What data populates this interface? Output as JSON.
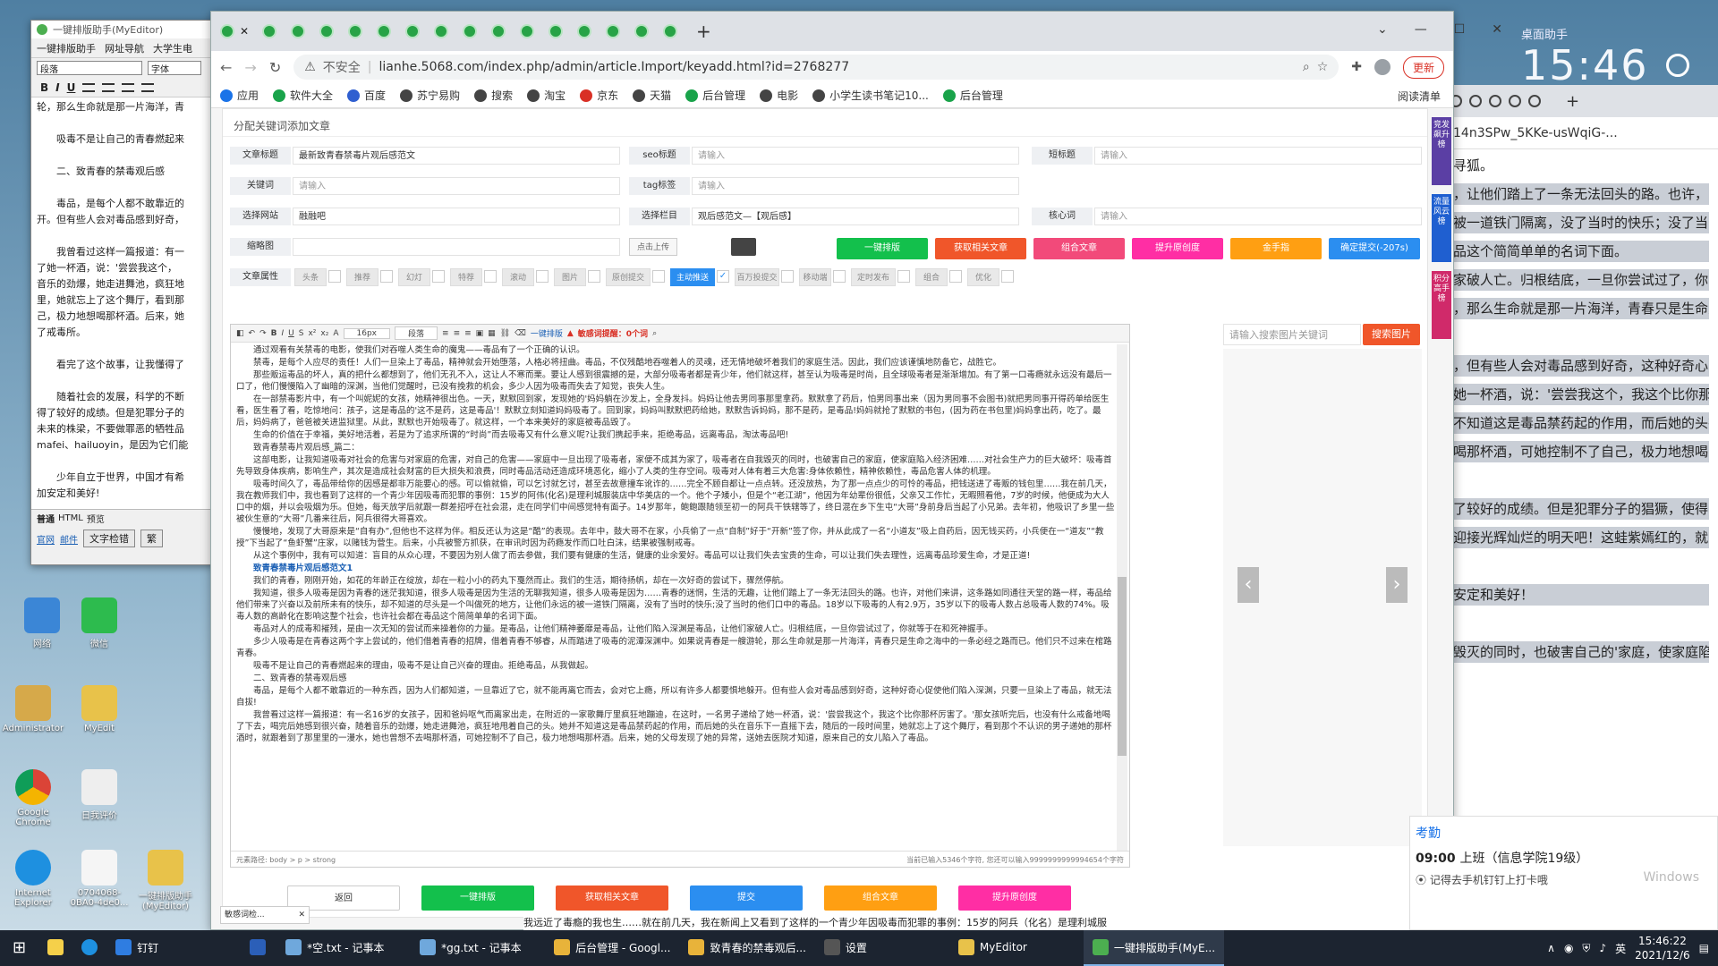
{
  "browser": {
    "url_security": "不安全",
    "url": "lianhe.5068.com/index.php/admin/article.Import/keyadd.html?id=2768277",
    "update_label": "更新",
    "bookmarks": [
      "应用",
      "软件大全",
      "百度",
      "苏宁易购",
      "搜索",
      "淘宝",
      "京东",
      "天猫",
      "后台管理",
      "电影",
      "小学生读书笔记10...",
      "后台管理"
    ],
    "reading_list": "阅读清单",
    "new_tab": "+"
  },
  "page": {
    "section_title": "分配关键词添加文章",
    "row1": {
      "title_label": "文章标题",
      "title_value": "最新致青春禁毒片观后感范文",
      "seo_label": "seo标题",
      "seo_placeholder": "请输入",
      "short_label": "短标题",
      "short_placeholder": "请输入"
    },
    "row2": {
      "kw_label": "关键词",
      "kw_placeholder": "请输入",
      "tag_label": "tag标签",
      "tag_placeholder": "请输入"
    },
    "row3": {
      "site_label": "选择网站",
      "site_value": "融融吧",
      "col_label": "选择栏目",
      "col_value": "观后感范文—【观后感】",
      "core_label": "核心词",
      "core_placeholder": "请输入"
    },
    "row4": {
      "thumb_label": "缩略图",
      "upload_label": "点击上传"
    },
    "action_buttons": [
      {
        "label": "一键排版",
        "color": "#13c04c"
      },
      {
        "label": "获取相关文章",
        "color": "#f0562a"
      },
      {
        "label": "组合文章",
        "color": "#f24a7a"
      },
      {
        "label": "提升原创度",
        "color": "#ff2ea4"
      },
      {
        "label": "金手指",
        "color": "#ff9f12"
      },
      {
        "label": "确定提交(-207s)",
        "color": "#2b8ef0"
      }
    ],
    "attr_label": "文章属性",
    "attrs": [
      "头条",
      "推荐",
      "幻灯",
      "特荐",
      "滚动",
      "图片",
      "原创提交",
      "主动推送",
      "百万投提交",
      "移动端",
      "定时发布",
      "组合",
      "优化"
    ],
    "attr_active": "主动推送",
    "img_search_placeholder": "请输入搜索图片关键词",
    "img_search_button": "搜索图片",
    "toolbar_text": "一键排版",
    "toolbar_warning": "敏感词提醒：0个词",
    "editor_paragraphs": [
      "通过观看有关禁毒的电影，使我们对吞噬人类生命的魔鬼——毒品有了一个正确的认识。",
      "禁毒，是每个人应尽的责任！人们一旦染上了毒品，精神就会开始堕落，人格必将扭曲。毒品，不仅残酷地吞噬着人的灵魂，还无情地破坏着我们的家庭生活。因此，我们应该谨慎地防备它，战胜它。",
      "那些贩运毒品的坏人，真的把什么都想到了，他们无孔不入，这让人不寒而栗。要让人感到很震撼的是，大部分吸毒者都是青少年，他们就这样，甚至认为吸毒是时尚，且全球吸毒者是渐渐增加。有了第一口毒瘾就永远没有最后一口了，他们慢慢陷入了幽暗的深渊，当他们觉醒时，已没有挽救的机会，多少人因为吸毒而失去了知觉，丧失人生。",
      "在一部禁毒影片中，有一个叫妮妮的女孩，她精神很出色。一天，默默回到家，发现她的'妈妈躺在沙发上，全身发抖。妈妈让他去男同事那里拿药。默默拿了药后，怕男同事出来（因为男同事不会图书)就把男同事开得药单给医生看，医生看了看，吃惊地问：孩子，这是毒品的'这不是药，这是毒品'！默默立刻知道妈妈吸毒了。回到家，妈妈叫默默把药给她，默默告诉妈妈，那不是药，是毒品!妈妈就抢了默默的书包，(因为药在书包里)妈妈拿出药，吃了。最后，妈妈病了，爸爸被关进监狱里。从此，默默也开始吸毒了。就这样，一个本来美好的家庭被毒品毁了。",
      "生命的价值在于幸福，美好地活着，若是为了追求所谓的“时尚”而去吸毒又有什么意义呢?让我们携起手来，拒绝毒品，远离毒品，淘汰毒品吧!",
      "致青春禁毒片观后感_篇二：",
      "这部电影，让我知道吸毒对社会的危害与对家庭的危害，对自己的危害——家庭中一旦出现了吸毒者，家便不成其为家了，吸毒者在自我毁灭的同时，也破害自己的家庭，使家庭陷入经济困难……对社会生产力的巨大破坏：吸毒首先导致身体疾病，影响生产，其次是造成社会财富的巨大损失和浪费，同时毒品活动还造成环境恶化，缩小了人类的生存空间。吸毒对人体有着三大危害:身体依赖性，精神依赖性，毒品危害人体的机理。",
      "吸毒时间久了，毒品带给你的因感是都非万能要心的感。可以偷就偷，可以乞讨就乞讨，甚至去故意撞车讹诈的……完全不顾自都让一点点转。还没放热，为了那一点点少的可怜的毒品，把钱送进了毒贩的钱包里……我在前几天，我在教师我们中，我也看到了这样的一个青少年因吸毒而犯罪的事例：15岁的阿伟(化名)是理利城服装店中华美店的一个。他个子矮小，但是个“老江湖”，他因为年幼辈份很低，父亲又工作忙，无暇照看他，7岁的时候，他便成为大人口中的烟，并以会吸烟为乐。但她，每天放学后就跟一群差招呼在社会混，走在同学们中间感觉特有面子。14岁那年，鲍鲍跟随领至初一的阿兵干铁辖等了，终日混在乡下生屯“大哥”身前身后当起了小兄弟。去年初，他吸识了乡里一些被伙生意的“大哥”几番来往后，阿兵很得大哥喜欢。",
      "慢慢地，发现了大哥原来是“自有办”,但他也不这样为伴。相反还认为这是“酷”的表现。去年中，鼓大哥不在家，小兵偷了一点“自制”好于“开新”签了你，并从此成了一名“小道友”吸上自药后，因无钱买药，小兵便在一“道友”“教授”下当起了“鱼虾蟹”庄家，以赌钱为营生。后来，小兵被警方抓获，在审讯时因为药瘾发作而口吐白沫，结果被强制戒毒。",
      "从这个事例中，我有可以知道：盲目的从众心理，不要因为别人做了而去参做，我们要有健康的生活，健康的业余爱好。毒品可以让我们失去宝贵的生命，可以让我们失去理性，远离毒品珍爱生命，才是正道!",
      "致青春禁毒片观后感范文1",
      "我们的青春，刚刚开始，如花的年龄正在绽放，却在一粒小小的药丸下戛然而止。我们的生活，期待扬帆，却在一次好奇的尝试下，骤然停航。",
      "我知道，很多人吸毒是因为青春的迷茫我知道，很多人吸毒是因为生活的无聊我知道，很多人吸毒是因为……青春的迷惘，生活的无趣，让他们踏上了一条无法回头的路。也许，对他们来讲，这条路如同通往天堂的路一样，毒品给他们带来了兴奋以及前所未有的快乐，却不知道的尽头是一个叫做死的地方，让他们永远的被一道铁门隔离，没有了当时的快乐;没了当时的他们口中的毒品。18岁以下吸毒的人有2.9万，35岁以下的吸毒人数占总吸毒人数的74%。吸毒人数的高龄化在影响这整个社会，也许社会都在毒品这个简简单单的名词下面。",
      "毒品对人的成毒和摧残，是由一次无知的尝试而来操着你的力量。是毒品，让他们精神萎靡是毒品，让他们陷入深渊是毒品，让他们家破人亡。归根结底，一旦你尝试过了，你就等于在和死神握手。",
      "多少人吸毒是在青春这两个字上尝试的，他们借着青春的招牌，借着青春不够睿，从而踏进了吸毒的泥潭深渊中。如果说青春是一艘游轮，那么生命就是那一片海洋，青春只是生命之海中的一条必经之路而已。他们只不过来在棺路青春。",
      "吸毒不是让自己的青春燃起来的理由，吸毒不是让自己兴奋的理由。拒绝毒品，从我做起。",
      "二、致青春的禁毒观后感",
      "毒品，是每个人都不敢靠近的一种东西，因为人们都知道，一旦靠近了它，就不能再离它而去，会对它上瘾，所以有许多人都要惧地躲开。但有些人会对毒品感到好奇，这种好奇心促使他们陷入深渊，只要一旦染上了毒品，就无法自拔!",
      "我曾看过这样一篇报道：有一名16岁的女孩子，因和爸妈呕气而离家出走，在附近的一家歌舞厅里疯狂地蹦迪，在这时，一名男子递给了她一杯酒，说：'尝尝我这个，我这个比你那杯厉害了。'那女孩听完后，也没有什么戒备地喝了下去，喝完后她感到很兴奋，随着音乐的劲爆，她走进舞池，疯狂地甩着自己的头。她并不知道这是毒品禁药起的作用，而后她的头在音乐下一直摇下去，随后的一段时间里，她就忘上了这个舞厅，看到那个不认识的男子递她的那杯酒时，就跟着到了那里里的一漫水，她也曾想不去喝那杯酒，可她控制不了自己，极力地想喝那杯酒。后来，她的父母发现了她的异常，送她去医院才知道，原来自己的女儿陷入了毒品。"
    ],
    "editor_status_path": "元素路径: body > p > strong",
    "editor_status_count": "当前已输入5346个字符, 您还可以输入9999999999994654个字符",
    "bottom_buttons": [
      {
        "label": "返回",
        "color": "#ffffff",
        "text": "#333333"
      },
      {
        "label": "一键排版",
        "color": "#13c04c",
        "text": "#ffffff"
      },
      {
        "label": "获取相关文章",
        "color": "#f0562a",
        "text": "#ffffff"
      },
      {
        "label": "提交",
        "color": "#2b8ef0",
        "text": "#ffffff"
      },
      {
        "label": "组合文章",
        "color": "#ff9f12",
        "text": "#ffffff"
      },
      {
        "label": "提升原创度",
        "color": "#ff2ea4",
        "text": "#ffffff"
      }
    ],
    "side_tabs": [
      {
        "label": "竞发飙升榜",
        "color": "#5b3fa4"
      },
      {
        "label": "流量风云榜",
        "color": "#1f5fd0"
      },
      {
        "label": "积分高手榜",
        "color": "#d02a6a"
      }
    ]
  },
  "left_app": {
    "title": "一键排版助手(MyEditor)",
    "menu": [
      "一键排版助手",
      "网址导航",
      "大学生电"
    ],
    "paragraph_select": "段落",
    "font_select": "字体",
    "fmt_buttons": [
      "B",
      "I",
      "U"
    ],
    "lines": [
      "轮，那么生命就是那一片海洋，青",
      "",
      "吸毒不是让自己的青春燃起来",
      "",
      "二、致青春的禁毒观后感",
      "",
      "毒品，是每个人都不敢靠近的",
      "开。但有些人会对毒品感到好奇，",
      "",
      "我曾看过这样一篇报道：有一",
      "了她一杯酒，说：'尝尝我这个，",
      "音乐的劲爆，她走进舞池，疯狂地",
      "里，她就忘上了这个舞厅，看到那",
      "己，极力地想喝那杯酒。后来，她",
      "了戒毒所。",
      "",
      "看完了这个故事，让我懂得了",
      "",
      "随着社会的发展，科学的不断",
      "得了较好的成绩。但是犯罪分子的",
      "未来的株梁，不要做罪恶的牺牲品",
      "mafei、hailuoyin，是因为它们能",
      "",
      "少年自立于世界，中国才有希",
      "加安定和美好!"
    ],
    "bottom_tabs": [
      "普通",
      "HTML",
      "预览"
    ],
    "links": [
      "官网",
      "邮件"
    ],
    "check_btn": "文字检错",
    "trad_btn": "繁"
  },
  "right_browser": {
    "url_fragment": "14n3SPw_5KKe-usWqiG-...",
    "lines": [
      "寻狐。",
      "，让他们踏上了一条无法回头的路。也许，",
      "被一道铁门隔离，没了当时的快乐；没了当时",
      "品这个简简单单的名词下面。",
      "家破人亡。归根结底，一旦你尝试过了，你",
      "，那么生命就是那一片海洋，青春只是生命之",
      "",
      "，但有些人会对毒品感到好奇，这种好奇心",
      "她一杯酒，说：'尝尝我这个，我这个比你那",
      "不知道这是毒品禁药起的作用，而后她的头在",
      "喝那杯酒，可她控制不了自己，极力地想喝",
      "",
      "了较好的成绩。但是犯罪分子的猖獗，使得",
      "迎接光辉灿烂的明天吧！这蛙紫嫣红的，就",
      "",
      "安定和美好！",
      "",
      "毁灭的同时，也破害自己的'家庭，使家庭陷"
    ]
  },
  "desktop": {
    "clock_label": "桌面助手",
    "clock_time": "15:46",
    "icons": [
      "网络",
      "微信",
      "Administrator",
      "MyEdit",
      "Google Chrome",
      "日我评价",
      "Internet Explorer",
      "0704068-0BA0-4de0...",
      "一键排版助手(MyEditor)"
    ],
    "notification": {
      "title": "考勤",
      "time": "09:00",
      "event": "上班（信息学院19级）",
      "location": "记得去手机钉钉上打卡哦",
      "windows_text": "Windows"
    },
    "bottom_snippet": "我远近了毒瘾的我也生……就在前几天，我在新闻上又看到了这样的一个青少年因吸毒而犯罪的事例：15岁的阿兵（化名）是理利城服"
  },
  "taskbar": {
    "items": [
      {
        "label": "钉钉",
        "color": "#2f7de1"
      },
      {
        "label": "",
        "color": "#2b5fb8"
      },
      {
        "label": "*空.txt - 记事本",
        "color": "#6fa8dc"
      },
      {
        "label": "*gg.txt - 记事本",
        "color": "#6fa8dc"
      },
      {
        "label": "后台管理 - Googl...",
        "color": "#e8b33a"
      },
      {
        "label": "致青春的禁毒观后...",
        "color": "#e8b33a"
      },
      {
        "label": "设置",
        "color": "#555555"
      },
      {
        "label": "MyEditor",
        "color": "#e8c24a"
      },
      {
        "label": "一键排版助手(MyE...",
        "color": "#4caf50"
      }
    ],
    "active": "一键排版助手(MyE...",
    "ime": "英",
    "time": "15:46:22",
    "date": "2021/12/6"
  },
  "mini_window": {
    "title": "敏感词检..."
  },
  "colors": {
    "accent": "#2b8ef0",
    "search_btn": "#f0562a",
    "chrome_tab": "#27a346"
  }
}
